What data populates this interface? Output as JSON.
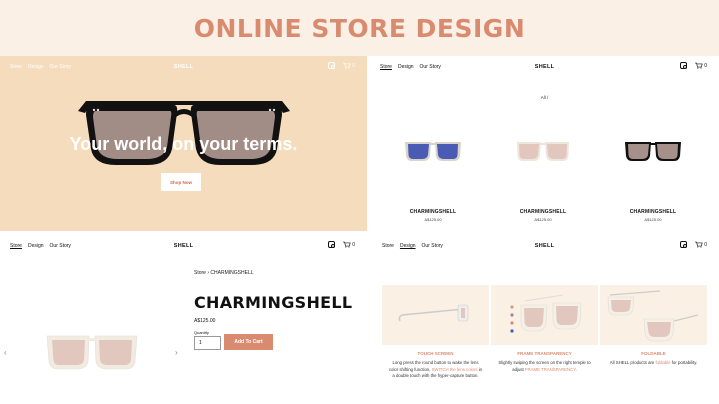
{
  "page": {
    "title": "ONLINE STORE DESIGN"
  },
  "colors": {
    "accent": "#d98b70",
    "hero_bg": "#f4dcbd",
    "header_bg": "#fbf0e6"
  },
  "nav": {
    "links": [
      "Store",
      "Design",
      "Our Story"
    ],
    "brand": "SHELL",
    "cart_count": "0",
    "icons": [
      "instagram-icon",
      "cart-icon"
    ]
  },
  "hero": {
    "tagline": "Your world, on your terms.",
    "cta": "Shop Now"
  },
  "catalog": {
    "filter": "All /",
    "products": [
      {
        "name": "CHARMINGSHELL",
        "price": "A$125.00",
        "lens_color": "#4a5bb4",
        "frame_color": "#d8d2c8"
      },
      {
        "name": "CHARMINGSHELL",
        "price": "A$125.00",
        "lens_color": "#e2c7bf",
        "frame_color": "#ece6dc"
      },
      {
        "name": "CHARMINGSHELL",
        "price": "A$125.00",
        "lens_color": "#a5908a",
        "frame_color": "#111111"
      }
    ]
  },
  "product_page": {
    "breadcrumb": [
      "Store",
      "CHARMINGSHELL"
    ],
    "breadcrumb_sep": "›",
    "name": "CHARMINGSHELL",
    "price": "A$125.00",
    "quantity_label": "Quantity",
    "quantity_value": "1",
    "add_to_cart": "Add To Cart",
    "prev_arrow": "‹",
    "next_arrow": "›"
  },
  "features": [
    {
      "title": "TOUCH SCREEN",
      "desc_pre": "Long press the round button to wake the lens color shifting function, ",
      "desc_hl": "SWITCH the lens colors",
      "desc_post": " in a double touch with the hyper-capture button."
    },
    {
      "title": "FRAME TRANSPARENCY",
      "desc_pre": "Slightly swiping the screen on the right temple to adjust ",
      "desc_hl": "FRAME TRANSPARENCY",
      "desc_post": "."
    },
    {
      "title": "FOLDABLE",
      "desc_pre": "All SHELL products are ",
      "desc_hl": "foldable",
      "desc_post": " for portability."
    }
  ]
}
